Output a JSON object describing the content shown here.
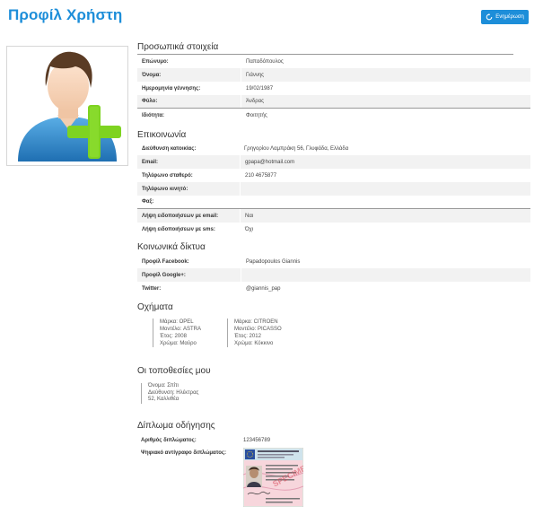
{
  "header": {
    "title": "Προφίλ Χρήστη",
    "refresh_label": "Ενημέρωση"
  },
  "personal": {
    "title": "Προσωπικά στοιχεία",
    "rows": [
      {
        "label": "Επώνυμο:",
        "value": "Παπαδόπουλος"
      },
      {
        "label": "Όνομα:",
        "value": "Γιάννης"
      },
      {
        "label": "Ημερομηνία γέννησης:",
        "value": "19/02/1987"
      },
      {
        "label": "Φύλο:",
        "value": "Άνδρας"
      },
      {
        "label": "Ιδιότητα:",
        "value": "Φοιτητής"
      }
    ]
  },
  "contact": {
    "title": "Επικοινωνία",
    "rows": [
      {
        "label": "Διεύθυνση κατοικίας:",
        "value": "Γρηγορίου Λαμπράκη 56, Γλυφάδα, Ελλάδα"
      },
      {
        "label": "Email:",
        "value": "gpapa@hotmail.com"
      },
      {
        "label": "Τηλέφωνο σταθερό:",
        "value": "210 4675877"
      },
      {
        "label": "Τηλέφωνο κινητό:",
        "value": ""
      },
      {
        "label": "Φαξ:",
        "value": ""
      },
      {
        "label": "Λήψη ειδοποιήσεων με email:",
        "value": "Ναι"
      },
      {
        "label": "Λήψη ειδοποιήσεων με sms:",
        "value": "Όχι"
      }
    ]
  },
  "social": {
    "title": "Κοινωνικά δίκτυα",
    "rows": [
      {
        "label": "Προφίλ Facebook:",
        "value": "Papadopoulos Giannis"
      },
      {
        "label": "Προφίλ Google+:",
        "value": ""
      },
      {
        "label": "Twitter:",
        "value": "@giannis_pap"
      }
    ]
  },
  "vehicles": {
    "title": "Οχήματα",
    "items": [
      {
        "brand": "Μάρκα: OPEL",
        "model": "Μοντέλο: ASTRA",
        "year": "Έτος: 2008",
        "color": "Χρώμα: Μαύρο"
      },
      {
        "brand": "Μάρκα: CITROEN",
        "model": "Μοντέλο: PICASSO",
        "year": "Έτος: 2012",
        "color": "Χρώμα: Κόκκινο"
      }
    ]
  },
  "locations": {
    "title": "Οι τοποθεσίες μου",
    "items": [
      {
        "name": "Όνομα: Σπίτι",
        "address_line1": "Διεύθυνση: Ηλέκτρας",
        "address_line2": "52, Καλλιθέα"
      }
    ]
  },
  "license": {
    "title": "Δίπλωμα οδήγησης",
    "number_label": "Αριθμός διπλώματος:",
    "number_value": "123456789",
    "copy_label": "Ψηφιακό αντίγραφο διπλώματος:"
  },
  "colors": {
    "accent": "#1d8ed9",
    "plus_green": "#7ed321",
    "shirt_blue": "#3a8fd0"
  }
}
